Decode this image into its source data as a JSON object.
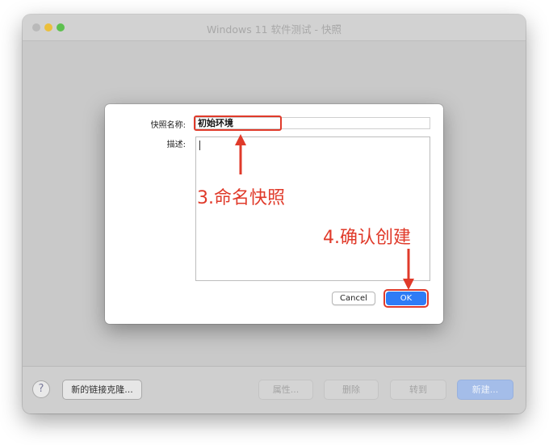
{
  "window": {
    "title": "Windows 11 软件测试 - 快照",
    "traffic_lights": [
      "close",
      "minimize",
      "zoom"
    ]
  },
  "dialog": {
    "name_label": "快照名称:",
    "name_value": "初始环境",
    "desc_label": "描述:",
    "desc_value": "",
    "cancel_label": "Cancel",
    "ok_label": "OK"
  },
  "footer": {
    "help_label": "?",
    "clone_label": "新的链接克隆...",
    "props_label": "属性...",
    "delete_label": "删除",
    "goto_label": "转到",
    "new_label": "新建..."
  },
  "annotations": {
    "step3": "3.命名快照",
    "step4": "4.确认创建"
  },
  "colors": {
    "annotation": "#e03a2a",
    "ok_button": "#2e7cf6",
    "new_button_disabled": "#a4bde9",
    "window_bg": "#c9c9c9"
  }
}
